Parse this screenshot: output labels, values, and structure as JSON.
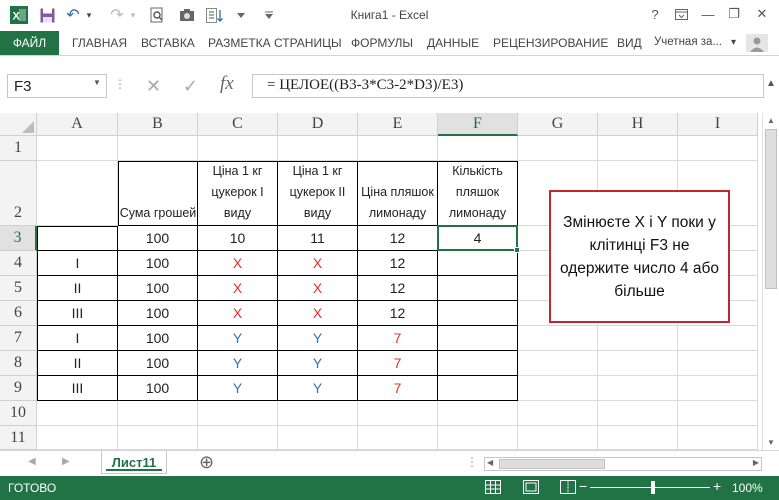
{
  "window": {
    "title": "Книга1 - Excel",
    "help": "?",
    "minimize": "—",
    "restore": "❐",
    "close": "✕"
  },
  "quick_access": {
    "save": "💾",
    "undo": "↶",
    "redo": "↷",
    "print_preview": "⎙",
    "camera": "📷",
    "sort": "⇅",
    "more": "▾"
  },
  "ribbon": {
    "file": "ФАЙЛ",
    "tabs": [
      "ГЛАВНАЯ",
      "ВСТАВКА",
      "РАЗМЕТКА СТРАНИЦЫ",
      "ФОРМУЛЫ",
      "ДАННЫЕ",
      "РЕЦЕНЗИРОВАНИЕ",
      "ВИД"
    ],
    "account": "Учетная за...",
    "account_arrow": "▾"
  },
  "formula_bar": {
    "name_box": "F3",
    "formula": "= ЦЕЛОЕ((B3-3*C3-2*D3)/E3)",
    "cancel": "✕",
    "enter": "✓",
    "fx": "fx"
  },
  "columns": [
    "A",
    "B",
    "C",
    "D",
    "E",
    "F",
    "G",
    "H",
    "I"
  ],
  "rows": [
    "1",
    "2",
    "3",
    "4",
    "5",
    "6",
    "7",
    "8",
    "9",
    "10",
    "11"
  ],
  "headers": {
    "B": "Сума грошей",
    "C": "Ціна 1 кг цукерок І виду",
    "D": "Ціна 1 кг цукерок ІІ виду",
    "E": "Ціна пляшок лимонаду",
    "F": "Кількість пляшок лимонаду"
  },
  "table_rows": [
    {
      "A": "",
      "B": "100",
      "C": "10",
      "D": "11",
      "E": "12",
      "F": "4"
    },
    {
      "A": "I",
      "B": "100",
      "C": "X",
      "D": "X",
      "E": "12",
      "F": ""
    },
    {
      "A": "II",
      "B": "100",
      "C": "X",
      "D": "X",
      "E": "12",
      "F": ""
    },
    {
      "A": "III",
      "B": "100",
      "C": "X",
      "D": "X",
      "E": "12",
      "F": ""
    },
    {
      "A": "I",
      "B": "100",
      "C": "Y",
      "D": "Y",
      "E": "7",
      "F": ""
    },
    {
      "A": "II",
      "B": "100",
      "C": "Y",
      "D": "Y",
      "E": "7",
      "F": ""
    },
    {
      "A": "III",
      "B": "100",
      "C": "Y",
      "D": "Y",
      "E": "7",
      "F": ""
    }
  ],
  "callout": "Змінюєте X і Y поки у клітинці F3 не одержите число 4 або більше",
  "sheet_tab": "Лист11",
  "add_sheet": "⊕",
  "status": {
    "text": "ГОТОВО",
    "zoom": "100%",
    "minus": "−",
    "plus": "+"
  },
  "colors": {
    "accent": "#217346",
    "x_color": "#e0302a",
    "y_color": "#2e75b6",
    "callout_border": "#c0282d"
  }
}
